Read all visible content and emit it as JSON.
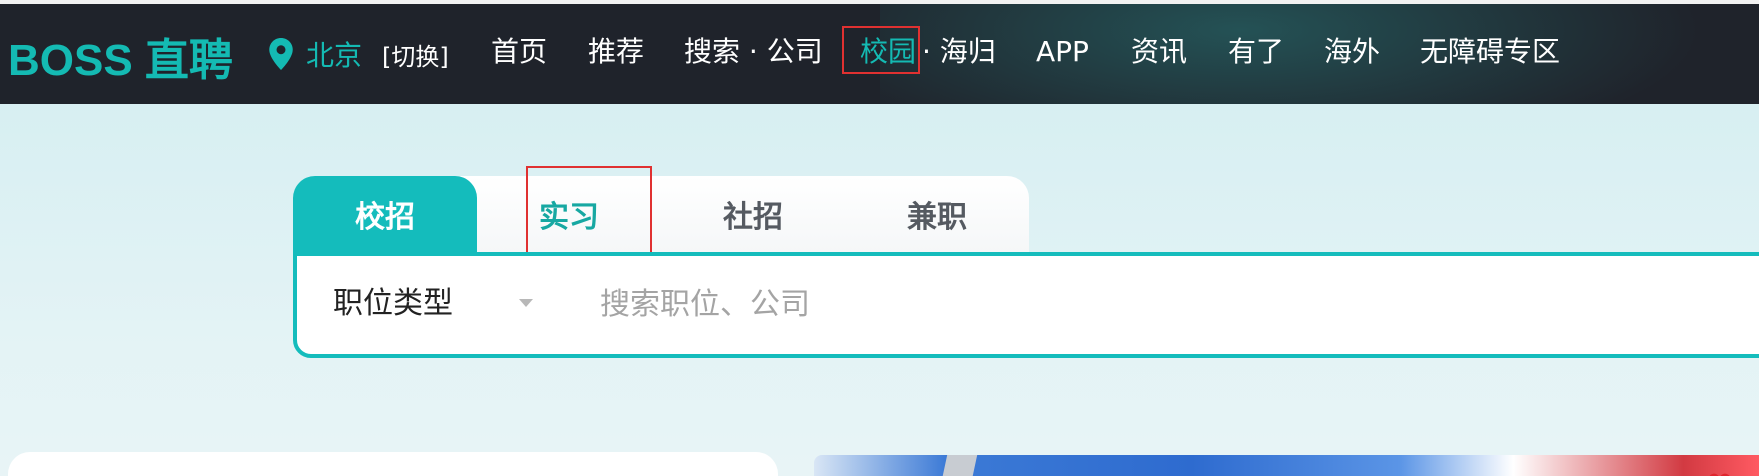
{
  "header": {
    "logo_text": "BOSS 直聘",
    "location": {
      "icon": "map-pin-icon",
      "city": "北京",
      "switch_label": "[切换]"
    },
    "nav_items": [
      {
        "label": "首页"
      },
      {
        "label": "推荐"
      },
      {
        "label": "搜索 · 公司"
      },
      {
        "label": "校园",
        "active": true
      },
      {
        "label": "· 海归"
      },
      {
        "label": "APP"
      },
      {
        "label": "资讯"
      },
      {
        "label": "有了"
      },
      {
        "label": "海外"
      },
      {
        "label": "无障碍专区"
      }
    ]
  },
  "tabs": [
    {
      "label": "校招",
      "active": true
    },
    {
      "label": "实习"
    },
    {
      "label": "社招"
    },
    {
      "label": "兼职"
    }
  ],
  "search": {
    "job_type_label": "职位类型",
    "placeholder": "搜索职位、公司"
  },
  "colors": {
    "brand": "#14bab3",
    "nav_bg": "#1f232b",
    "highlight_box": "#e03131",
    "page_bg": "#ddf0f3"
  }
}
